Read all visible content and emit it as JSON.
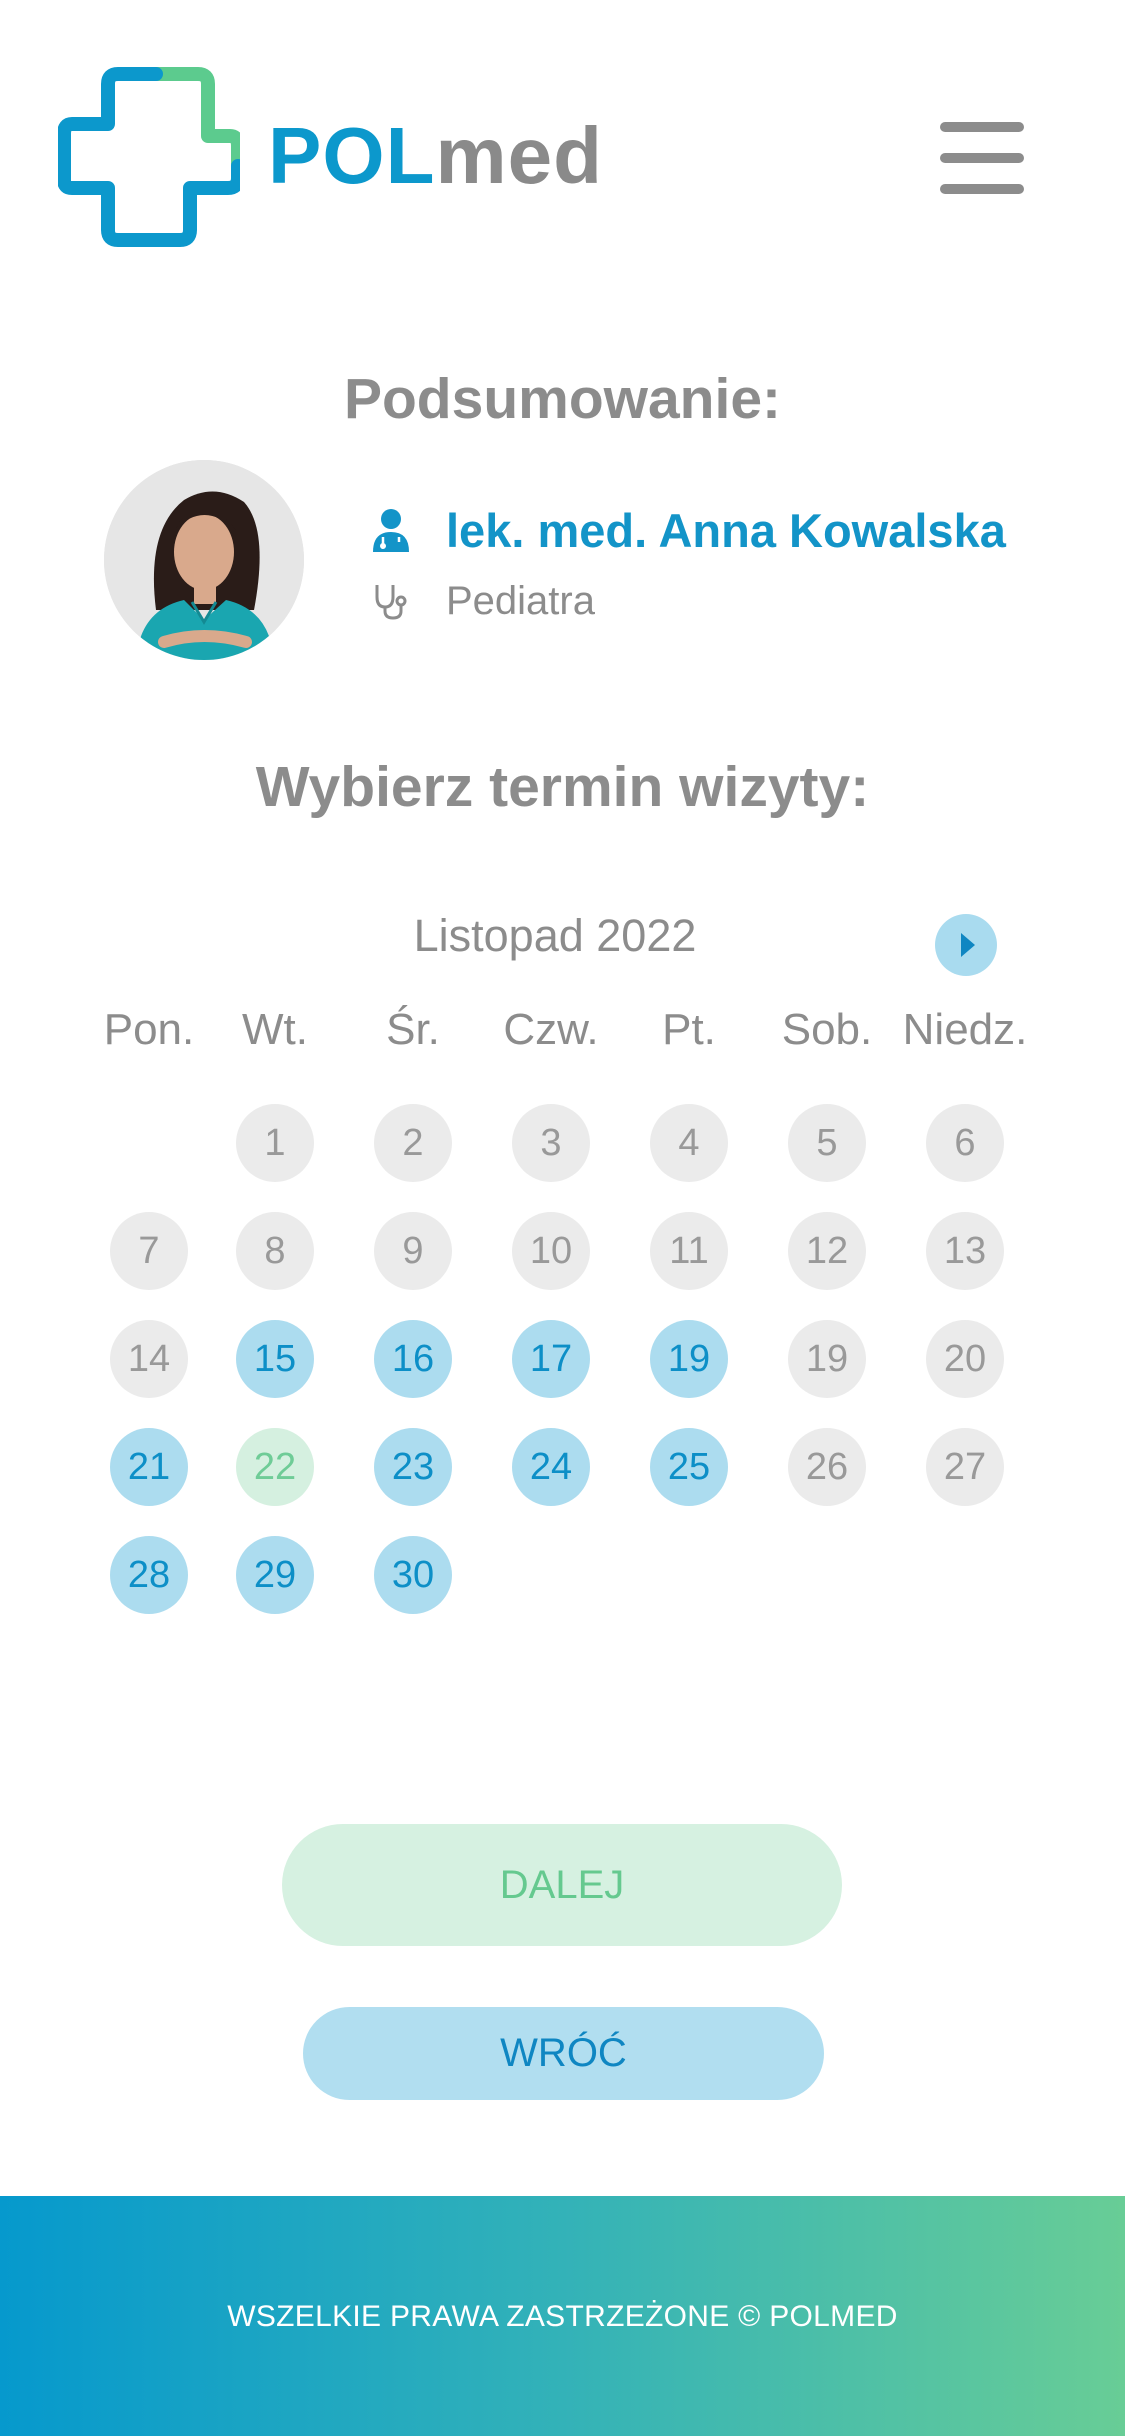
{
  "brand": {
    "part1": "POL",
    "part2": "med",
    "color_primary": "#0c98cc",
    "color_secondary": "#5ccb8e"
  },
  "header": {
    "menu_icon": "hamburger-menu-icon"
  },
  "summary": {
    "title": "Podsumowanie:",
    "doctor_name": "lek. med. Anna Kowalska",
    "specialty": "Pediatra",
    "doctor_icon": "doctor-person-icon",
    "specialty_icon": "stethoscope-icon"
  },
  "calendar": {
    "title": "Wybierz termin wizyty:",
    "month": "Listopad 2022",
    "next_icon": "arrow-right-icon",
    "weekdays": [
      "Pon.",
      "Wt.",
      "Śr.",
      "Czw.",
      "Pt.",
      "Sob.",
      "Niedz."
    ],
    "weeks": [
      [
        null,
        {
          "label": "1",
          "state": "unavailable"
        },
        {
          "label": "2",
          "state": "unavailable"
        },
        {
          "label": "3",
          "state": "unavailable"
        },
        {
          "label": "4",
          "state": "unavailable"
        },
        {
          "label": "5",
          "state": "unavailable"
        },
        {
          "label": "6",
          "state": "unavailable"
        }
      ],
      [
        {
          "label": "7",
          "state": "unavailable"
        },
        {
          "label": "8",
          "state": "unavailable"
        },
        {
          "label": "9",
          "state": "unavailable"
        },
        {
          "label": "10",
          "state": "unavailable"
        },
        {
          "label": "11",
          "state": "unavailable"
        },
        {
          "label": "12",
          "state": "unavailable"
        },
        {
          "label": "13",
          "state": "unavailable"
        }
      ],
      [
        {
          "label": "14",
          "state": "unavailable"
        },
        {
          "label": "15",
          "state": "available"
        },
        {
          "label": "16",
          "state": "available"
        },
        {
          "label": "17",
          "state": "available"
        },
        {
          "label": "19",
          "state": "available"
        },
        {
          "label": "19",
          "state": "unavailable"
        },
        {
          "label": "20",
          "state": "unavailable"
        }
      ],
      [
        {
          "label": "21",
          "state": "available"
        },
        {
          "label": "22",
          "state": "selected"
        },
        {
          "label": "23",
          "state": "available"
        },
        {
          "label": "24",
          "state": "available"
        },
        {
          "label": "25",
          "state": "available"
        },
        {
          "label": "26",
          "state": "unavailable"
        },
        {
          "label": "27",
          "state": "unavailable"
        }
      ],
      [
        {
          "label": "28",
          "state": "available"
        },
        {
          "label": "29",
          "state": "available"
        },
        {
          "label": "30",
          "state": "available"
        },
        null,
        null,
        null,
        null
      ]
    ]
  },
  "actions": {
    "next_label": "DALEJ",
    "back_label": "WRÓĆ"
  },
  "footer": {
    "text": "WSZELKIE PRAWA ZASTRZEŻONE © POLMED"
  }
}
